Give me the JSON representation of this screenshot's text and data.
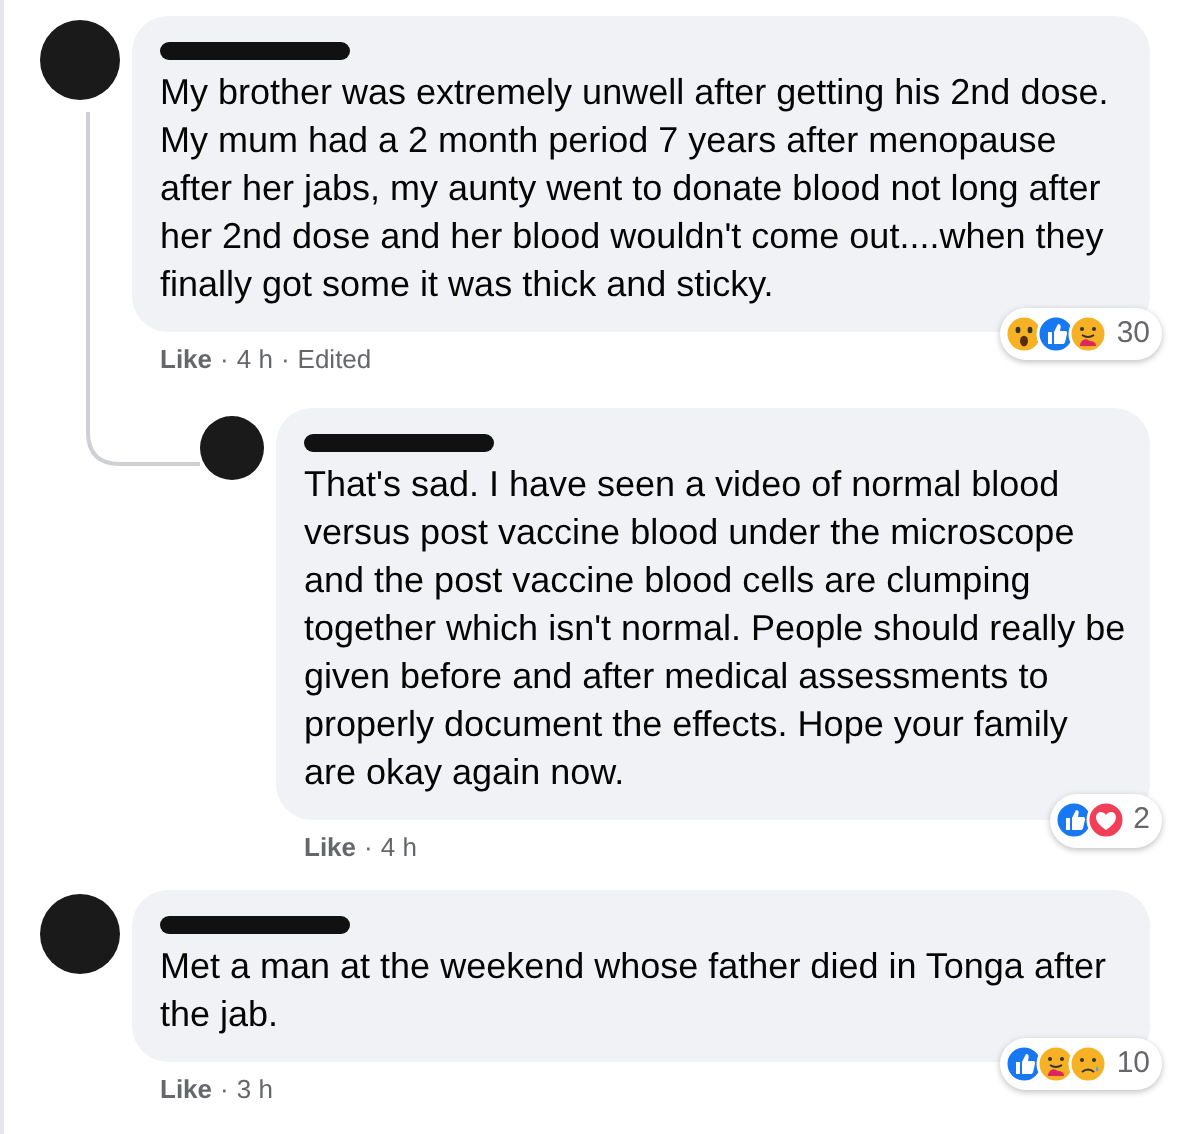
{
  "comments": [
    {
      "reply": false,
      "separator": "·",
      "edited_label": "Edited",
      "text": "My brother was extremely unwell after getting his 2nd dose. My mum had a 2 month period 7 years after menopause after her jabs, my aunty went to donate blood not long after her 2nd dose and her blood wouldn't come out....when they finally got some it was thick and sticky.",
      "like": "Like",
      "time": "4 h",
      "reactions": [
        {
          "kind": "wow"
        },
        {
          "kind": "like"
        },
        {
          "kind": "care"
        }
      ],
      "reaction_count": "30"
    },
    {
      "reply": true,
      "separator": "·",
      "text": "That's sad. I have seen a video of normal blood versus post vaccine blood under the microscope and the post vaccine blood cells are clumping together which isn't normal. People should really be given before and after medical assessments to properly document the effects. Hope your family are okay again now.",
      "like": "Like",
      "time": "4 h",
      "reactions": [
        {
          "kind": "like"
        },
        {
          "kind": "love"
        }
      ],
      "reaction_count": "2"
    },
    {
      "reply": false,
      "separator": "·",
      "text": "Met a man at the weekend whose father died in Tonga after the jab.",
      "like": "Like",
      "time": "3 h",
      "reactions": [
        {
          "kind": "like"
        },
        {
          "kind": "care"
        },
        {
          "kind": "sad"
        }
      ],
      "reaction_count": "10"
    }
  ]
}
